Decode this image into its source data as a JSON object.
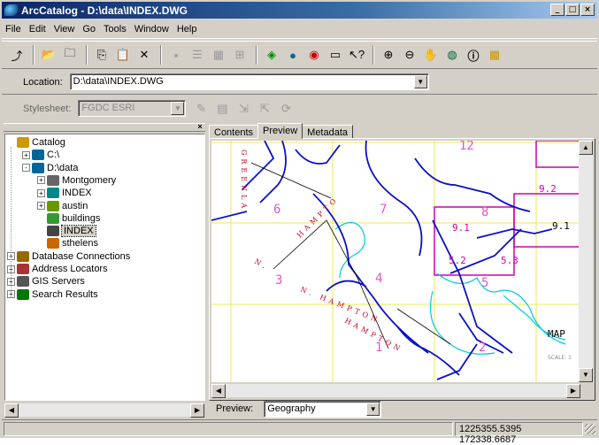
{
  "window": {
    "title": "ArcCatalog - D:\\data\\INDEX.DWG",
    "min": "_",
    "max": "□",
    "close": "×"
  },
  "menu": [
    "File",
    "Edit",
    "View",
    "Go",
    "Tools",
    "Window",
    "Help"
  ],
  "toolbar_icons": [
    "up-one-level-icon",
    "connect-folder-icon",
    "disconnect-folder-icon",
    "copy-icon",
    "paste-icon",
    "delete-icon",
    "large-icons-icon",
    "list-icon",
    "details-icon",
    "thumbnails-icon",
    "launch-arcmap-icon",
    "metadata-icon",
    "search-icon",
    "arctoolbox-icon",
    "whats-this-icon",
    "zoom-in-icon",
    "zoom-out-icon",
    "pan-icon",
    "full-extent-icon",
    "identify-icon",
    "create-thumbnail-icon"
  ],
  "location": {
    "label": "Location:",
    "value": "D:\\data\\INDEX.DWG"
  },
  "stylesheet": {
    "label": "Stylesheet:",
    "value": "FGDC ESRI"
  },
  "tree": [
    {
      "label": "Catalog",
      "depth": 0,
      "pm": "",
      "icon": "catalog-icon"
    },
    {
      "label": "C:\\",
      "depth": 1,
      "pm": "+",
      "icon": "drive-icon"
    },
    {
      "label": "D:\\data",
      "depth": 1,
      "pm": "-",
      "icon": "folder-connection-icon"
    },
    {
      "label": "Montgomery",
      "depth": 2,
      "pm": "+",
      "icon": "geodatabase-icon"
    },
    {
      "label": "INDEX",
      "depth": 2,
      "pm": "+",
      "icon": "cad-drawing-icon"
    },
    {
      "label": "austin",
      "depth": 2,
      "pm": "+",
      "icon": "raster-icon"
    },
    {
      "label": "buildings",
      "depth": 2,
      "pm": "",
      "icon": "shapefile-icon"
    },
    {
      "label": "INDEX",
      "depth": 2,
      "pm": "",
      "icon": "cad-file-icon",
      "selected": true
    },
    {
      "label": "sthelens",
      "depth": 2,
      "pm": "",
      "icon": "tin-icon"
    },
    {
      "label": "Database Connections",
      "depth": 0,
      "pm": "+",
      "icon": "database-connections-icon"
    },
    {
      "label": "Address Locators",
      "depth": 0,
      "pm": "+",
      "icon": "address-locators-icon"
    },
    {
      "label": "GIS Servers",
      "depth": 0,
      "pm": "+",
      "icon": "gis-servers-icon"
    },
    {
      "label": "Search Results",
      "depth": 0,
      "pm": "+",
      "icon": "search-results-icon"
    }
  ],
  "tabs": [
    {
      "label": "Contents",
      "active": false
    },
    {
      "label": "Preview",
      "active": true
    },
    {
      "label": "Metadata",
      "active": false
    }
  ],
  "map": {
    "grid_labels": [
      "12",
      "6",
      "7",
      "8",
      "9.1",
      "9.2",
      "4",
      "3",
      "5",
      "5.2",
      "5.3",
      "1",
      "2",
      "9.1"
    ],
    "street_labels": [
      "GREENLA",
      "HAMPTO",
      "N.",
      "N. HAMPTON",
      "HAMPTON"
    ],
    "map_word": "MAP",
    "scale_text": "SCALE: 1"
  },
  "preview": {
    "label": "Preview:",
    "value": "Geography"
  },
  "status": {
    "coords": "1225355.5395  172338.6687"
  },
  "colors": {
    "title_start": "#0a246a",
    "title_end": "#a6caf0",
    "face": "#d4d0c8",
    "map_blue": "#0a10c8",
    "map_cyan": "#00c8e6",
    "map_magenta": "#d000b0",
    "map_yellow": "#e8e85a",
    "grid_label": "#e058c8"
  }
}
